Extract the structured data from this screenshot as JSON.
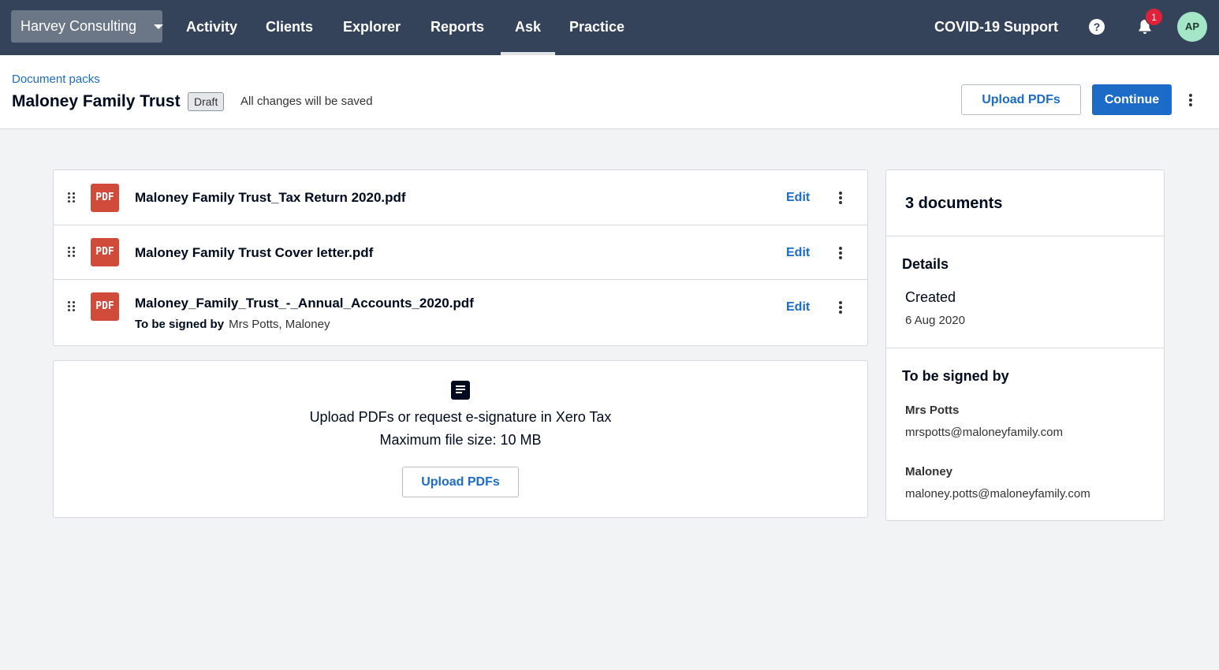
{
  "nav": {
    "org_name": "Harvey Consulting",
    "items": [
      {
        "label": "Activity"
      },
      {
        "label": "Clients"
      },
      {
        "label": "Explorer"
      },
      {
        "label": "Reports"
      },
      {
        "label": "Ask"
      },
      {
        "label": "Practice"
      }
    ],
    "active_item": "Ask",
    "covid_label": "COVID-19 Support",
    "help_glyph": "?",
    "notification_count": "1",
    "avatar_initials": "AP"
  },
  "header": {
    "breadcrumb": "Document packs",
    "title": "Maloney Family Trust",
    "status_badge": "Draft",
    "save_note": "All changes will be saved",
    "upload_button": "Upload PDFs",
    "continue_button": "Continue"
  },
  "documents": [
    {
      "icon_text": "PDF",
      "name": "Maloney Family Trust_Tax Return 2020.pdf",
      "edit_label": "Edit"
    },
    {
      "icon_text": "PDF",
      "name": "Maloney Family Trust Cover letter.pdf",
      "edit_label": "Edit"
    },
    {
      "icon_text": "PDF",
      "name": "Maloney_Family_Trust_-_Annual_Accounts_2020.pdf",
      "edit_label": "Edit",
      "signers_label": "To be signed by",
      "signers": "Mrs Potts, Maloney"
    }
  ],
  "upload": {
    "line1": "Upload PDFs or request e-signature in Xero Tax",
    "line2": "Maximum file size: 10 MB",
    "button": "Upload PDFs"
  },
  "sidebar": {
    "doc_count": "3 documents",
    "details_heading": "Details",
    "created_label": "Created",
    "created_value": "6 Aug 2020",
    "signers_heading": "To be signed by",
    "signers": [
      {
        "name": "Mrs Potts",
        "email": "mrspotts@maloneyfamily.com"
      },
      {
        "name": "Maloney",
        "email": "maloney.potts@maloneyfamily.com"
      }
    ]
  },
  "colors": {
    "nav_bg": "#34435a",
    "accent_blue": "#1c6bc7",
    "pdf_red": "#d14b3b",
    "badge_red": "#e0213b",
    "avatar_green": "#a6e6c8"
  }
}
